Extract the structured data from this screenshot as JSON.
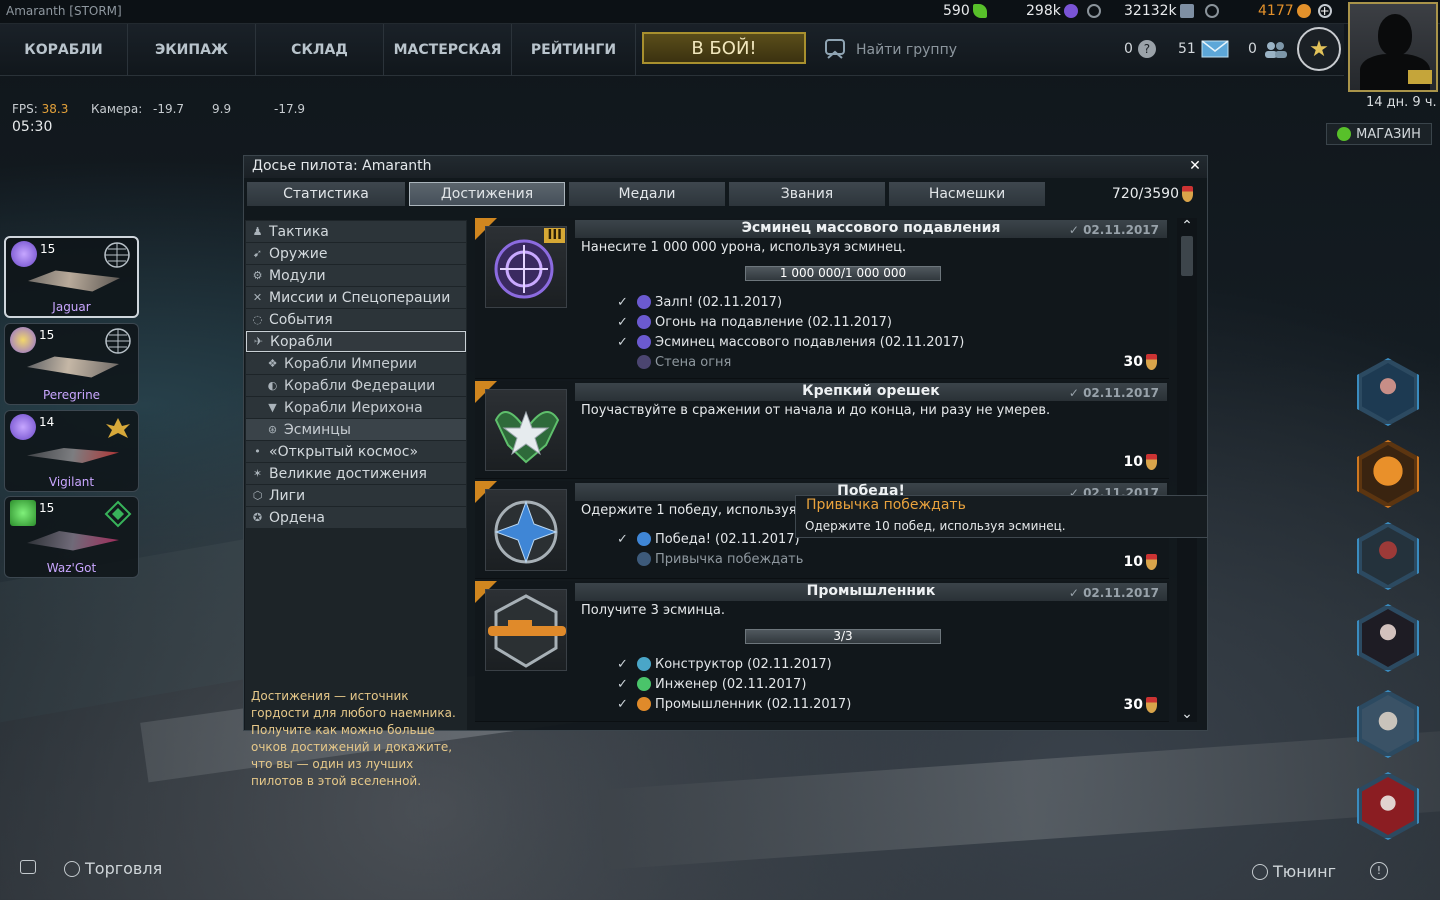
{
  "player": {
    "name": "Amaranth [STORM]"
  },
  "currencies": [
    {
      "value": "590",
      "icon": "credits-icon",
      "color": "#58c02a"
    },
    {
      "value": "298k",
      "icon": "synergy-icon",
      "color": "#7a54d6"
    },
    {
      "value": "32132k",
      "icon": "silver-icon",
      "color": "#7e8fa3"
    },
    {
      "value": "4177",
      "icon": "gold-icon",
      "color": "#e3912b"
    }
  ],
  "nav": {
    "items": [
      "КОРАБЛИ",
      "ЭКИПАЖ",
      "СКЛАД",
      "МАСТЕРСКАЯ",
      "РЕЙТИНГИ"
    ],
    "battle": "В БОЙ!",
    "find_group": "Найти группу",
    "help_count": "0",
    "mail_count": "51",
    "friends_count": "0"
  },
  "profile": {
    "time_left": "14 дн. 9 ч.",
    "shop": "МАГАЗИН"
  },
  "hud": {
    "fps_label": "FPS:",
    "fps_value": "38.3",
    "camera_label": "Камера:",
    "camera_x": "-19.7",
    "camera_y": "9.9",
    "camera_z": "-17.9",
    "clock": "05:30"
  },
  "ships": [
    {
      "name": "Jaguar",
      "level": "15",
      "active": true
    },
    {
      "name": "Peregrine",
      "level": "15",
      "active": false
    },
    {
      "name": "Vigilant",
      "level": "14",
      "active": false
    },
    {
      "name": "Waz'Got",
      "level": "15",
      "active": false
    }
  ],
  "dossier": {
    "title": "Досье пилота: Amaranth",
    "tabs": [
      "Статистика",
      "Достижения",
      "Медали",
      "Звания",
      "Насмешки"
    ],
    "selected_tab": "Достижения",
    "points": "720/3590",
    "categories": [
      {
        "label": "Тактика",
        "sub": false
      },
      {
        "label": "Оружие",
        "sub": false
      },
      {
        "label": "Модули",
        "sub": false
      },
      {
        "label": "Миссии и Спецоперации",
        "sub": false
      },
      {
        "label": "События",
        "sub": false
      },
      {
        "label": "Корабли",
        "sub": false,
        "selected": true
      },
      {
        "label": "Корабли Империи",
        "sub": true
      },
      {
        "label": "Корабли Федерации",
        "sub": true
      },
      {
        "label": "Корабли Иерихона",
        "sub": true
      },
      {
        "label": "Эсминцы",
        "sub": true,
        "selected": true
      },
      {
        "label": "«Открытый космос»",
        "sub": false
      },
      {
        "label": "Великие достижения",
        "sub": false
      },
      {
        "label": "Лиги",
        "sub": false
      },
      {
        "label": "Ордена",
        "sub": false
      }
    ],
    "hint": "Достижения — источник гордости для любого наемника. Получите как можно больше очков достижений и докажите, что вы — один из лучших пилотов в этой вселенной.",
    "achievements": [
      {
        "title": "Эсминец массового подавления",
        "date": "02.11.2017",
        "desc": "Нанесите 1 000 000 урона, используя эсминец.",
        "progress": "1 000 000/1 000 000",
        "progress_fraction": 1.0,
        "steps": [
          {
            "text": "Залп! (02.11.2017)",
            "done": true
          },
          {
            "text": "Огонь на подавление (02.11.2017)",
            "done": true
          },
          {
            "text": "Эсминец массового подавления (02.11.2017)",
            "done": true
          },
          {
            "text": "Стена огня",
            "done": false
          }
        ],
        "reward": "30",
        "tier": "III"
      },
      {
        "title": "Крепкий орешек",
        "date": "02.11.2017",
        "desc": "Поучаствуйте в сражении от начала и до конца, ни разу не умерев.",
        "reward": "10"
      },
      {
        "title": "Победа!",
        "date": "02.11.2017",
        "desc": "Одержите 1 победу, используя эсминец.",
        "steps": [
          {
            "text": "Победа! (02.11.2017)",
            "done": true
          },
          {
            "text": "Привычка побеждать",
            "done": false
          }
        ],
        "reward": "10"
      },
      {
        "title": "Промышленник",
        "date": "02.11.2017",
        "desc": "Получите 3 эсминца.",
        "progress": "3/3",
        "progress_fraction": 1.0,
        "steps": [
          {
            "text": "Конструктор (02.11.2017)",
            "done": true
          },
          {
            "text": "Инженер (02.11.2017)",
            "done": true
          },
          {
            "text": "Промышленник (02.11.2017)",
            "done": true
          }
        ],
        "reward": "30"
      }
    ],
    "tooltip": {
      "title": "Привычка побеждать",
      "desc": "Одержите 10 побед, используя эсминец."
    }
  },
  "bottom": {
    "trade": "Торговля",
    "tuning": "Тюнинг"
  }
}
